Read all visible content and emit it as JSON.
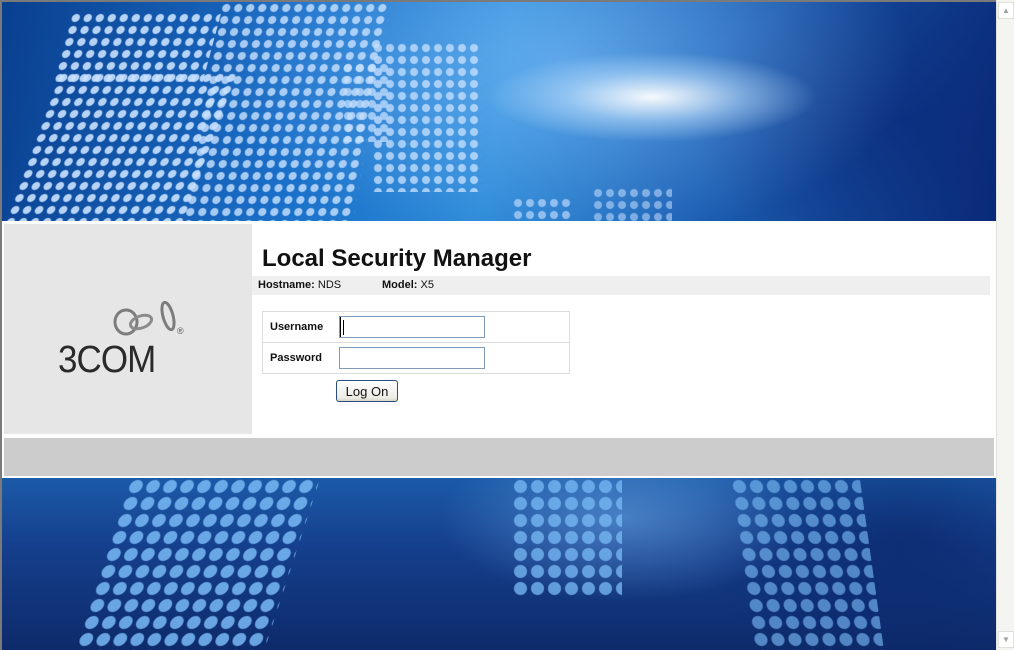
{
  "page": {
    "title": "Local Security Manager",
    "hostname_label": "Hostname:",
    "hostname_value": "NDS",
    "model_label": "Model:",
    "model_value": "X5"
  },
  "logo": {
    "text": "3COM",
    "registered_mark": "®",
    "icon": "3com-rings-logo"
  },
  "form": {
    "username_label": "Username",
    "username_value": "",
    "password_label": "Password",
    "password_value": "",
    "submit_label": "Log On"
  },
  "scrollbar": {
    "up_icon": "arrow-up-icon",
    "down_icon": "arrow-down-icon",
    "up_glyph": "▲",
    "down_glyph": "▼"
  },
  "colors": {
    "banner_blue": "#1a6fc8",
    "logo_panel": "#e6e6e6",
    "info_bar": "#efefef",
    "footer_bar": "#cccccc",
    "input_border": "#7f9db9"
  }
}
